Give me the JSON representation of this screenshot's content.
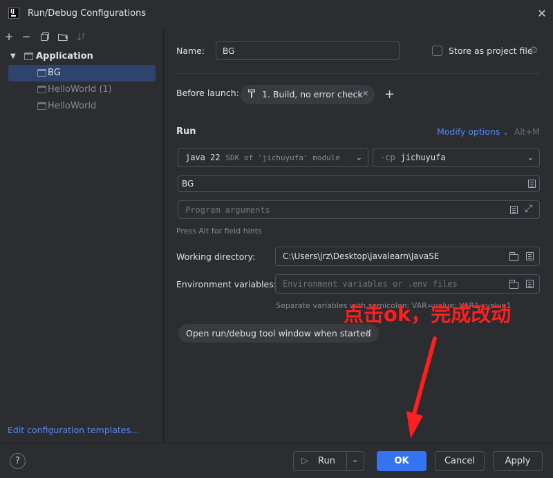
{
  "window": {
    "title": "Run/Debug Configurations",
    "app_icon_text": "IJ"
  },
  "toolbar": {
    "icons": [
      "add-icon",
      "remove-icon",
      "copy-icon",
      "folder-add-icon",
      "sort-icon"
    ]
  },
  "tree": {
    "group": "Application",
    "items": [
      {
        "label": "BG",
        "selected": true
      },
      {
        "label": "HelloWorld (1)",
        "selected": false
      },
      {
        "label": "HelloWorld",
        "selected": false
      }
    ]
  },
  "edit_templates_link": "Edit configuration templates...",
  "form": {
    "name_label": "Name:",
    "name_value": "BG",
    "store_label": "Store as project file",
    "before_launch_label": "Before launch:",
    "before_launch_task": "1. Build, no error check",
    "run_section": "Run",
    "modify_options": "Modify options",
    "modify_shortcut": "Alt+M",
    "jdk_prefix": "java 22",
    "jdk_suffix": "SDK of 'jichuyufa' module",
    "cp_prefix": "-cp",
    "cp_value": "jichuyufa",
    "main_class": "BG",
    "program_args_placeholder": "Program arguments",
    "field_hint": "Press Alt for field hints",
    "working_dir_label": "Working directory:",
    "working_dir_value": "C:\\Users\\jrz\\Desktop\\javalearn\\JavaSE",
    "env_label": "Environment variables:",
    "env_placeholder": "Environment variables or .env files",
    "env_hint": "Separate variables with semicolon: VAR=value; VAR1=value1",
    "tool_window_chip": "Open run/debug tool window when started"
  },
  "annotation": {
    "text": "点击ok，完成改动",
    "color": "#ff1f1f"
  },
  "footer": {
    "help": "?",
    "run_label": "Run",
    "ok_label": "OK",
    "cancel_label": "Cancel",
    "apply_label": "Apply"
  },
  "colors": {
    "accent": "#3574f0",
    "link": "#548af7",
    "selection": "#2e436e",
    "annotation": "#ff1f1f"
  }
}
